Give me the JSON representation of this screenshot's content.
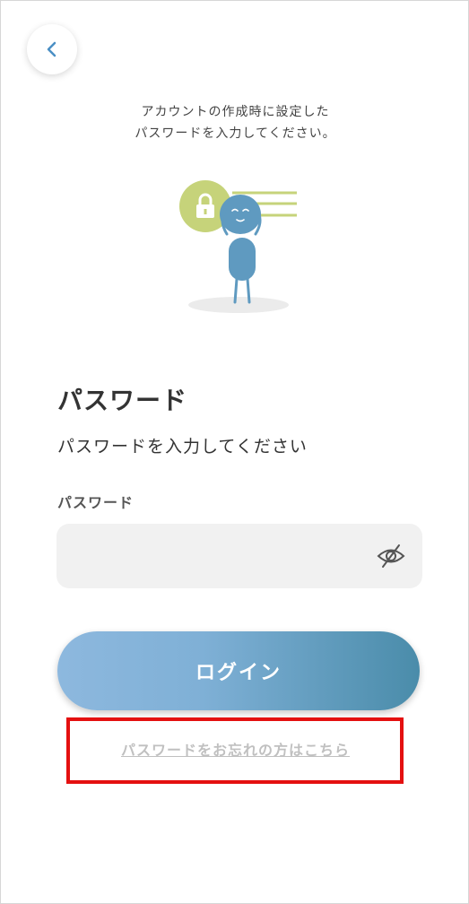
{
  "header": {
    "back_icon": "chevron-left-icon"
  },
  "intro": {
    "line1": "アカウントの作成時に設定した",
    "line2": "パスワードを入力してください。"
  },
  "illustration": {
    "icon": "person-with-lock-illustration",
    "colors": {
      "lock_circle": "#c6d37a",
      "person": "#5f9ac0",
      "shadow": "#ebebeb"
    }
  },
  "page": {
    "title": "パスワード",
    "subtitle": "パスワードを入力してください"
  },
  "password": {
    "label": "パスワード",
    "value": "",
    "placeholder": "",
    "toggle_icon": "eye-slash-icon"
  },
  "login": {
    "label": "ログイン",
    "gradient": [
      "#8db8de",
      "#4a8caa"
    ]
  },
  "forgot": {
    "label": "パスワードをお忘れの方はこちら",
    "highlight_color": "#e41010"
  }
}
